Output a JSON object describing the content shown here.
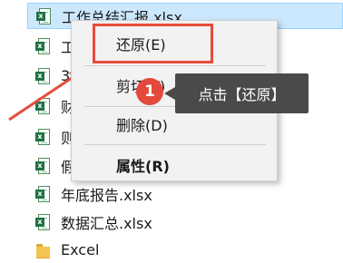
{
  "files": [
    {
      "name": "工作总结汇报.xlsx",
      "type": "xlsx",
      "selected": true
    },
    {
      "name": "工",
      "type": "xlsx"
    },
    {
      "name": "3",
      "type": "xlsx"
    },
    {
      "name": "财",
      "type": "xlsx"
    },
    {
      "name": "则",
      "type": "xlsx"
    },
    {
      "name": "假",
      "type": "xlsx"
    },
    {
      "name": "年底报告.xlsx",
      "type": "xlsx"
    },
    {
      "name": "数据汇总.xlsx",
      "type": "xlsx"
    },
    {
      "name": "Excel",
      "type": "folder"
    }
  ],
  "context_menu": {
    "restore": "还原(E)",
    "cut": "剪切(T)",
    "delete": "删除(D)",
    "properties": "属性(R)"
  },
  "annotation": {
    "step": "1",
    "callout_text": "点击【还原】",
    "highlight_color": "#e74c3c"
  },
  "icons": {
    "excel": "excel-file-icon",
    "folder": "folder-icon"
  },
  "colors": {
    "selection": "#cce8ff",
    "menu_bg": "#f2f2f2",
    "callout_bg": "#4a4a4a",
    "badge": "#e34a3c"
  }
}
